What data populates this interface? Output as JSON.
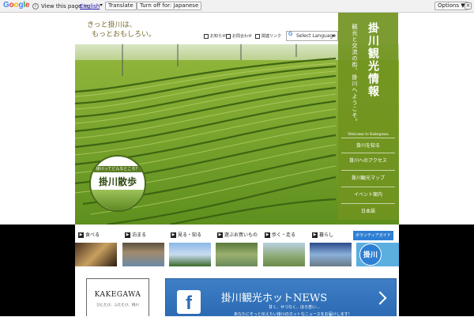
{
  "translate_bar": {
    "logo": [
      "G",
      "o",
      "o",
      "g",
      "l",
      "e"
    ],
    "view_text": "View this page in:",
    "language": "English",
    "translate_button": "Translate",
    "turn_off_button": "Turn off for: Japanese",
    "options_button": "Options ▼",
    "close": "×"
  },
  "header": {
    "tagline_line1": "きっと掛川は、",
    "tagline_line2": "もっとおもしろい。",
    "links": [
      "お知らせ",
      "お問合わせ",
      "関連リンク"
    ],
    "language_select": "Select Language"
  },
  "sidebar": {
    "title": "掛川観光情報",
    "subtitle": "観光と交流の街、掛川へようこそ。",
    "welcome": "Welcome to Kakegawa",
    "menu": [
      "掛川を知る",
      "掛川へのアクセス",
      "掛川観光マップ",
      "イベント案内",
      "日本語"
    ]
  },
  "badge": {
    "top": "掛川ってどんなところ？",
    "main": "掛川散歩"
  },
  "categories": [
    "食べる",
    "泊まる",
    "見る・知る",
    "遊ぶお買いもの",
    "歩く・走る",
    "暮らし",
    "ボランティアガイド"
  ],
  "volunteer_thumb_label": "掛川",
  "bottom": {
    "kakegawa_title": "KAKEGAWA",
    "kakegawa_sub": "ひとたび、ふたたび、掛川",
    "fb_icon": "f",
    "news_title": "掛川観光ホットNEWS",
    "news_line1": "甘く、せつなく、ほろ苦い…",
    "news_line2": "あなたにそっと伝えたい掛川のホットなニュースをお届けします！"
  },
  "colors": {
    "sidebar_green": "#719420",
    "news_blue": "#2c6bb4",
    "volunteer_blue": "#2d7fd4"
  }
}
